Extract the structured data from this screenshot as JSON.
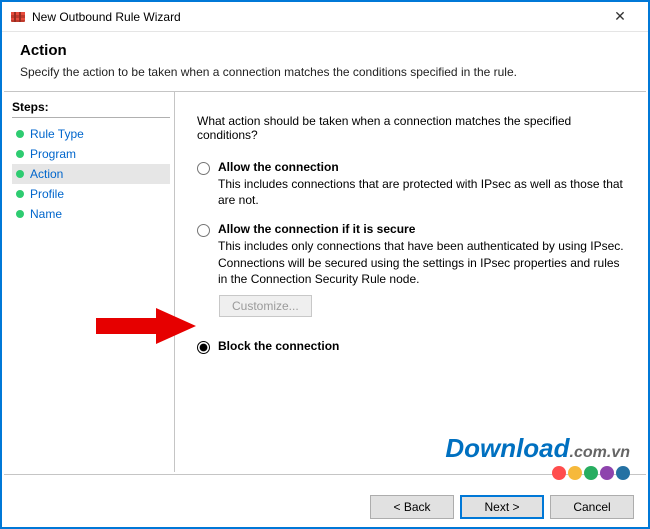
{
  "window": {
    "title": "New Outbound Rule Wizard",
    "close_glyph": "✕"
  },
  "header": {
    "title": "Action",
    "description": "Specify the action to be taken when a connection matches the conditions specified in the rule."
  },
  "sidebar": {
    "label": "Steps:",
    "items": [
      {
        "label": "Rule Type"
      },
      {
        "label": "Program"
      },
      {
        "label": "Action"
      },
      {
        "label": "Profile"
      },
      {
        "label": "Name"
      }
    ],
    "selected_index": 2
  },
  "main": {
    "prompt": "What action should be taken when a connection matches the specified conditions?",
    "options": {
      "allow": {
        "label": "Allow the connection",
        "description": "This includes connections that are protected with IPsec as well as those that are not."
      },
      "allow_secure": {
        "label": "Allow the connection if it is secure",
        "description": "This includes only connections that have been authenticated by using IPsec. Connections will be secured using the settings in IPsec properties and rules in the Connection Security Rule node."
      },
      "block": {
        "label": "Block the connection"
      }
    },
    "customize_label": "Customize...",
    "selected": "block"
  },
  "footer": {
    "back": "< Back",
    "next": "Next >",
    "cancel": "Cancel"
  },
  "watermark": {
    "brand": "Download",
    "suffix": ".com.vn"
  }
}
